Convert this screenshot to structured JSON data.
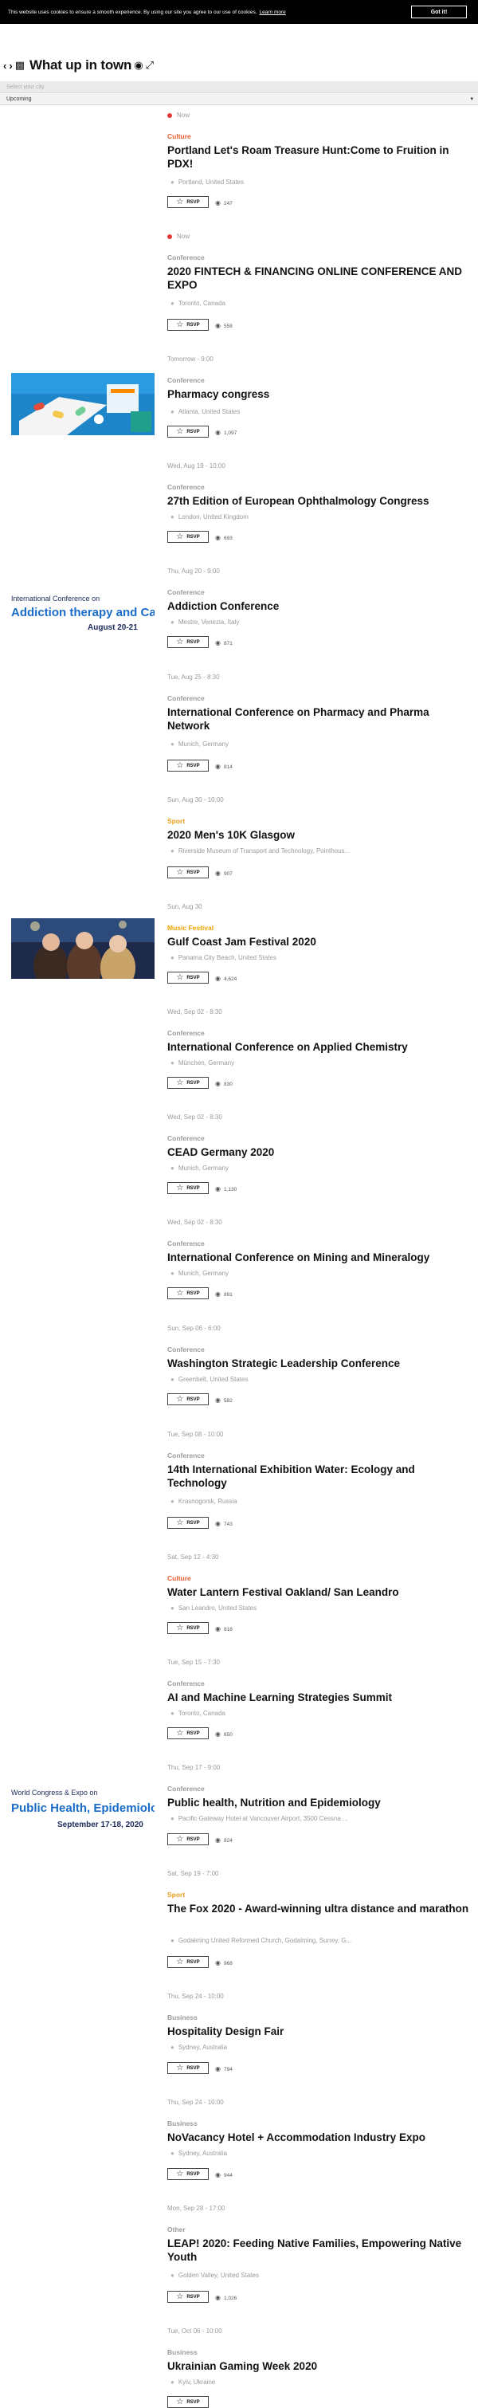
{
  "cookie": {
    "message": "This website uses cookies to ensure a smooth experience. By using our site you agree to our use of cookies.",
    "learn_more": "Learn more",
    "accept": "Got it!"
  },
  "header": {
    "prev_icon": "chevron-left-icon",
    "next_icon": "chevron-right-icon",
    "title": "What up in town"
  },
  "filters": {
    "city_placeholder": "Select your city",
    "range_value": "Upcoming"
  },
  "colors": {
    "culture": "#e65c2e",
    "sport": "#e6a01e",
    "music": "#f0a500",
    "neutral_category": "#9a9a9a",
    "live_dot": "#e53935"
  },
  "rsvp_label": "RSVP",
  "events": [
    {
      "when": "Now",
      "live": true,
      "category": "Culture",
      "title": "Portland Let's Roam Treasure Hunt:Come to Fruition in PDX!",
      "location": "Portland, United States",
      "views": "247"
    },
    {
      "when": "Now",
      "live": true,
      "category": "Conference",
      "title": "2020 FINTECH & FINANCING ONLINE CONFERENCE AND EXPO",
      "location": "Toronto, Canada",
      "views": "558"
    },
    {
      "when": "Tomorrow - 9:00",
      "category": "Conference",
      "title": "Pharmacy congress",
      "location": "Atlanta, United States",
      "views": "1,097",
      "thumb": "pharmacy"
    },
    {
      "when": "Wed, Aug 19 - 10:00",
      "category": "Conference",
      "title": "27th Edition of European Ophthalmology Congress",
      "location": "London, United Kingdom",
      "views": "693"
    },
    {
      "when": "Thu, Aug 20 - 9:00",
      "category": "Conference",
      "title": "Addiction Conference",
      "location": "Mestre, Venezia, Italy",
      "views": "871",
      "thumb": "addiction",
      "thumb_lines": [
        "International Conference on",
        "Addiction therapy and Care",
        "August 20-21"
      ]
    },
    {
      "when": "Tue, Aug 25 - 8:30",
      "category": "Conference",
      "title": "International Conference on Pharmacy and Pharma Network",
      "location": "Munich, Germany",
      "views": "814"
    },
    {
      "when": "Sun, Aug 30 - 10:00",
      "category": "Sport",
      "title": "2020 Men's 10K Glasgow",
      "location": "Riverside Museum of Transport and Technology, Pointhous...",
      "views": "907"
    },
    {
      "when": "Sun, Aug 30",
      "category": "Music Festival",
      "title": "Gulf Coast Jam Festival 2020",
      "location": "Panama City Beach, United States",
      "views": "4,624",
      "thumb": "festival"
    },
    {
      "when": "Wed, Sep 02 - 8:30",
      "category": "Conference",
      "title": "International Conference on Applied Chemistry",
      "location": "München, Germany",
      "views": "830"
    },
    {
      "when": "Wed, Sep 02 - 8:30",
      "category": "Conference",
      "title": "CEAD Germany 2020",
      "location": "Munich, Germany",
      "views": "1,130"
    },
    {
      "when": "Wed, Sep 02 - 8:30",
      "category": "Conference",
      "title": "International Conference on Mining and Mineralogy",
      "location": "Munich, Germany",
      "views": "891"
    },
    {
      "when": "Sun, Sep 06 - 6:00",
      "category": "Conference",
      "title": "Washington Strategic Leadership Conference",
      "location": "Greenbelt, United States",
      "views": "582"
    },
    {
      "when": "Tue, Sep 08 - 10:00",
      "category": "Conference",
      "title": "14th International Exhibition Water: Ecology and Technology",
      "location": "Krasnogorsk, Russia",
      "views": "743"
    },
    {
      "when": "Sat, Sep 12 - 4:30",
      "category": "Culture",
      "title": "Water Lantern Festival Oakland/ San Leandro",
      "location": "San Leandro, United States",
      "views": "818"
    },
    {
      "when": "Tue, Sep 15 - 7:30",
      "category": "Conference",
      "title": "AI and Machine Learning Strategies Summit",
      "location": "Toronto, Canada",
      "views": "650"
    },
    {
      "when": "Thu, Sep 17 - 9:00",
      "category": "Conference",
      "title": "Public health, Nutrition and Epidemiology",
      "location": "Pacific Gateway Hotel at Vancouver Airport, 3500 Cessna ...",
      "views": "824",
      "thumb": "publichealth",
      "thumb_lines": [
        "World Congress & Expo on",
        "Public Health, Epidemiology",
        "September 17-18, 2020"
      ]
    },
    {
      "when": "Sat, Sep 19 - 7:00",
      "category": "Sport",
      "title": "The Fox 2020 - Award-winning ultra distance and marathon",
      "location": "Godalming United Reformed Church, Godalming, Surrey, G...",
      "views": "968"
    },
    {
      "when": "Thu, Sep 24 - 10:00",
      "category": "Business",
      "title": "Hospitality Design Fair",
      "location": "Sydney, Australia",
      "views": "794"
    },
    {
      "when": "Thu, Sep 24 - 10:00",
      "category": "Business",
      "title": "NoVacancy Hotel + Accommodation Industry Expo",
      "location": "Sydney, Australia",
      "views": "944"
    },
    {
      "when": "Mon, Sep 28 - 17:00",
      "category": "Other",
      "title": "LEAP! 2020: Feeding Native Families, Empowering Native Youth",
      "location": "Golden Valley, United States",
      "views": "1,026"
    },
    {
      "when": "Tue, Oct 06 - 10:00",
      "category": "Business",
      "title": "Ukrainian Gaming Week 2020",
      "location": "Kyiv, Ukraine",
      "views": ""
    }
  ]
}
